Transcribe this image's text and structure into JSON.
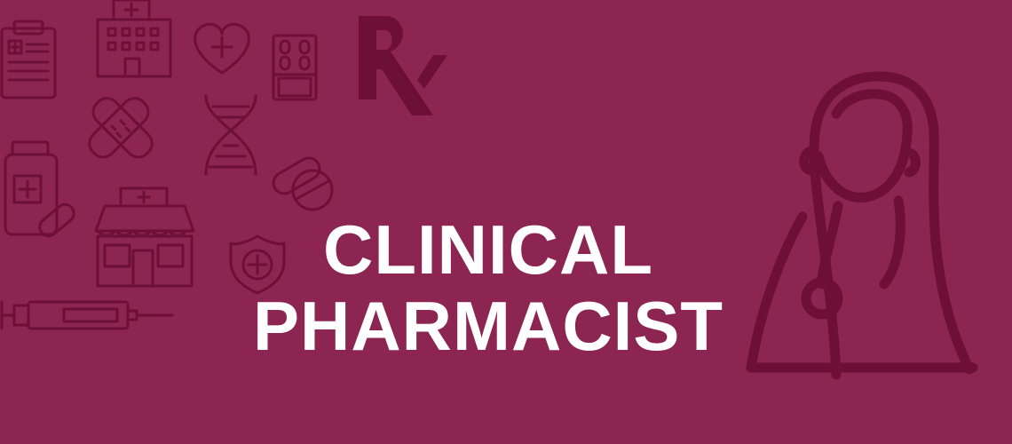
{
  "banner": {
    "title_line_1": "CLINICAL",
    "title_line_2": "PHARMACIST",
    "prescription_symbol": "Rx"
  },
  "colors": {
    "background": "#8c2551",
    "icon_stroke": "#6e0f35",
    "title_text": "#ffffff"
  },
  "icons": [
    "clipboard-icon",
    "hospital-icon",
    "heart-cross-icon",
    "pill-blister-icon",
    "rx-icon",
    "bandage-icon",
    "dna-icon",
    "capsule-tablet-icon",
    "medicine-bottle-icon",
    "pharmacy-store-icon",
    "shield-cross-icon",
    "syringe-icon",
    "pharmacist-person-icon"
  ]
}
